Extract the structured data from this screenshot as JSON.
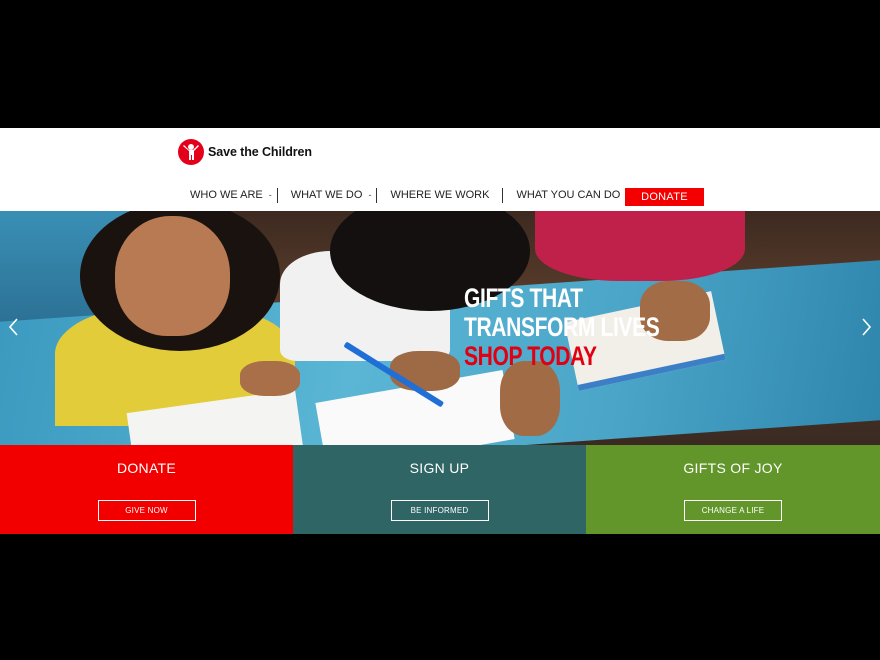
{
  "brand": {
    "name": "Save the Children",
    "logo_icon": "child-figure-icon",
    "color": "#e4001b"
  },
  "nav": {
    "items": [
      {
        "label": "WHO WE ARE",
        "has_dropdown": true
      },
      {
        "label": "WHAT WE DO",
        "has_dropdown": true
      },
      {
        "label": "WHERE WE WORK",
        "has_dropdown": false
      },
      {
        "label": "WHAT YOU CAN DO",
        "has_dropdown": true
      }
    ],
    "dropdown_marker": "-",
    "donate_label": "DONATE"
  },
  "hero": {
    "line1": "GIFTS THAT",
    "line2": "TRANSFORM LIVES",
    "line3": "SHOP TODAY",
    "prev_icon": "chevron-left-icon",
    "next_icon": "chevron-right-icon"
  },
  "tiles": [
    {
      "title": "DONATE",
      "button": "GIVE NOW",
      "color": "#f20000"
    },
    {
      "title": "SIGN UP",
      "button": "BE INFORMED",
      "color": "#2f6565"
    },
    {
      "title": "GIFTS OF JOY",
      "button": "CHANGE A LIFE",
      "color": "#62962a"
    }
  ]
}
